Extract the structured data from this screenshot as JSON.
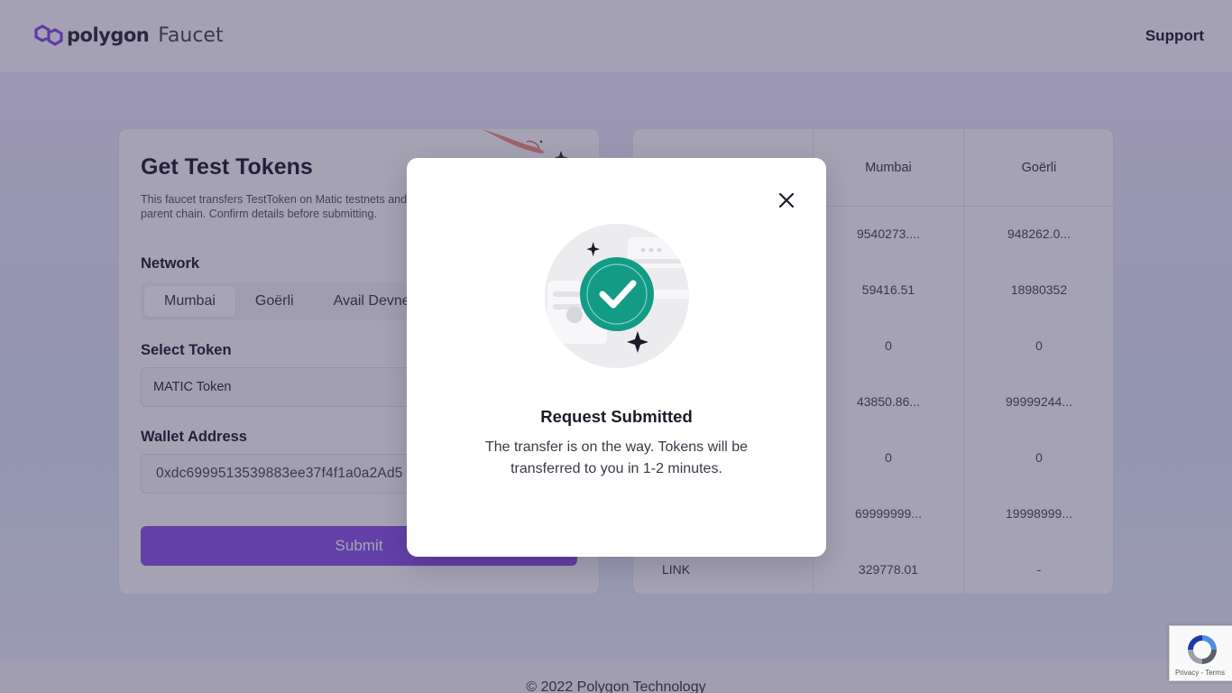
{
  "header": {
    "brand": "polygon",
    "product": "Faucet",
    "support_label": "Support"
  },
  "form": {
    "title": "Get Test Tokens",
    "description": "This faucet transfers TestToken on Matic testnets and parent chain. Confirm details before submitting.",
    "network_label": "Network",
    "networks": [
      "Mumbai",
      "Goërli",
      "Avail Devnet"
    ],
    "selected_network": "Mumbai",
    "token_label": "Select Token",
    "token_value": "MATIC Token",
    "wallet_label": "Wallet Address",
    "wallet_value": "0xdc6999513539883ee37f4f1a0a2Ad5",
    "submit_label": "Submit"
  },
  "table": {
    "columns": [
      "",
      "Mumbai",
      "Goërli"
    ],
    "rows": [
      {
        "token": "",
        "mumbai": "9540273....",
        "goerli": "948262.0..."
      },
      {
        "token": "",
        "mumbai": "59416.51",
        "goerli": "18980352"
      },
      {
        "token": "",
        "mumbai": "0",
        "goerli": "0"
      },
      {
        "token": "",
        "mumbai": "43850.86...",
        "goerli": "99999244..."
      },
      {
        "token": "",
        "mumbai": "0",
        "goerli": "0"
      },
      {
        "token": "",
        "mumbai": "69999999...",
        "goerli": "19998999..."
      },
      {
        "token": "LINK",
        "mumbai": "329778.01",
        "goerli": "-"
      }
    ]
  },
  "footer": {
    "copyright": "© 2022 Polygon Technology"
  },
  "recaptcha": {
    "terms": "Privacy - Terms"
  },
  "modal": {
    "title": "Request Submitted",
    "body": "The transfer is on the way. Tokens will be transferred to you in 1-2 minutes."
  },
  "colors": {
    "brand_purple": "#8247e5",
    "success_teal": "#139b86"
  }
}
